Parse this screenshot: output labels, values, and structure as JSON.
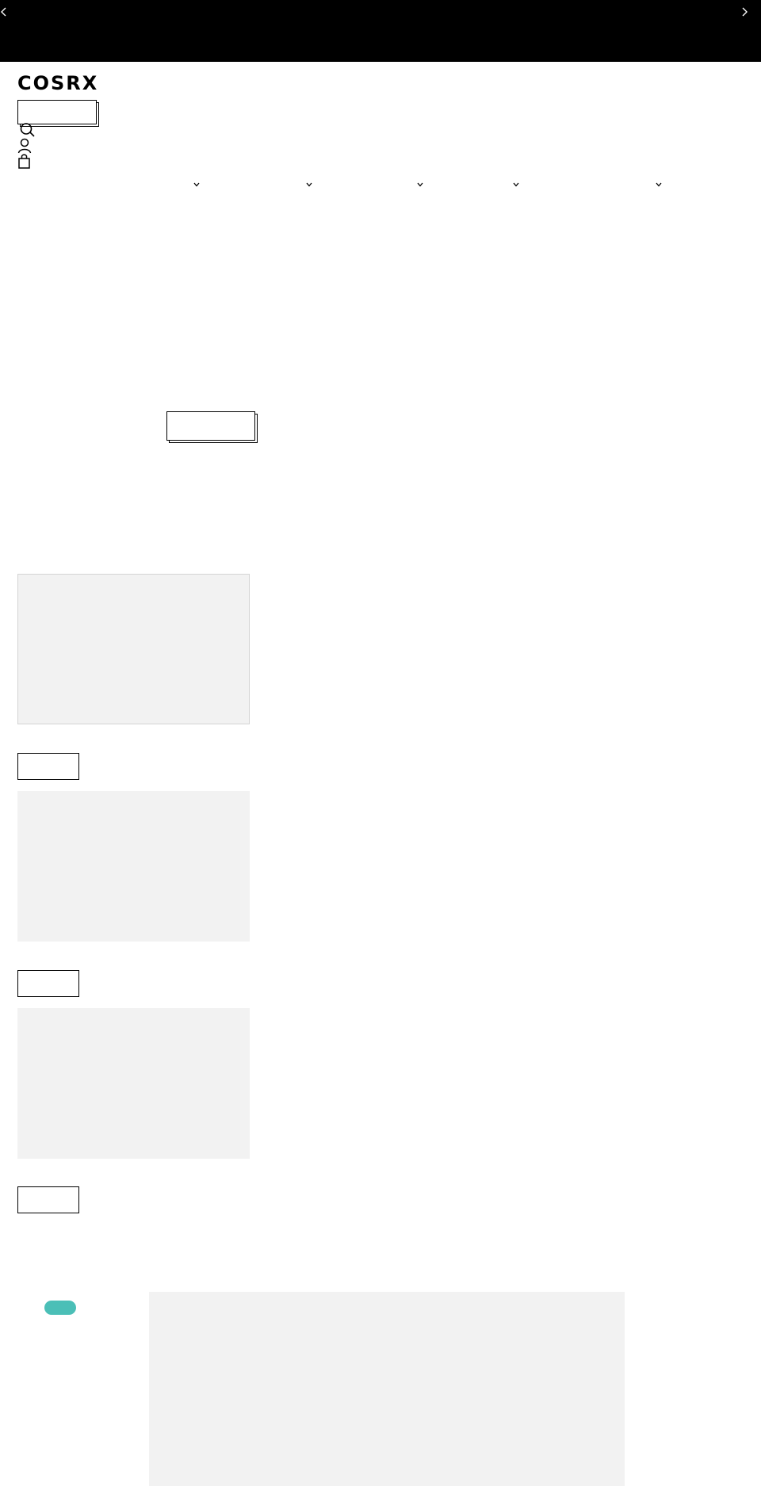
{
  "colors": {
    "announcement_bg": "#000000",
    "placeholder_bg": "#f2f2f2",
    "badge": "#4bbfb7"
  },
  "announcement": {
    "prev_icon": "chevron-left-icon",
    "next_icon": "chevron-right-icon"
  },
  "header": {
    "logo": "COSRX",
    "icons": [
      "search-icon",
      "account-icon",
      "cart-icon"
    ]
  },
  "nav": {
    "dropdown_icon": "chevron-down-icon",
    "dropdown_count": 5
  }
}
